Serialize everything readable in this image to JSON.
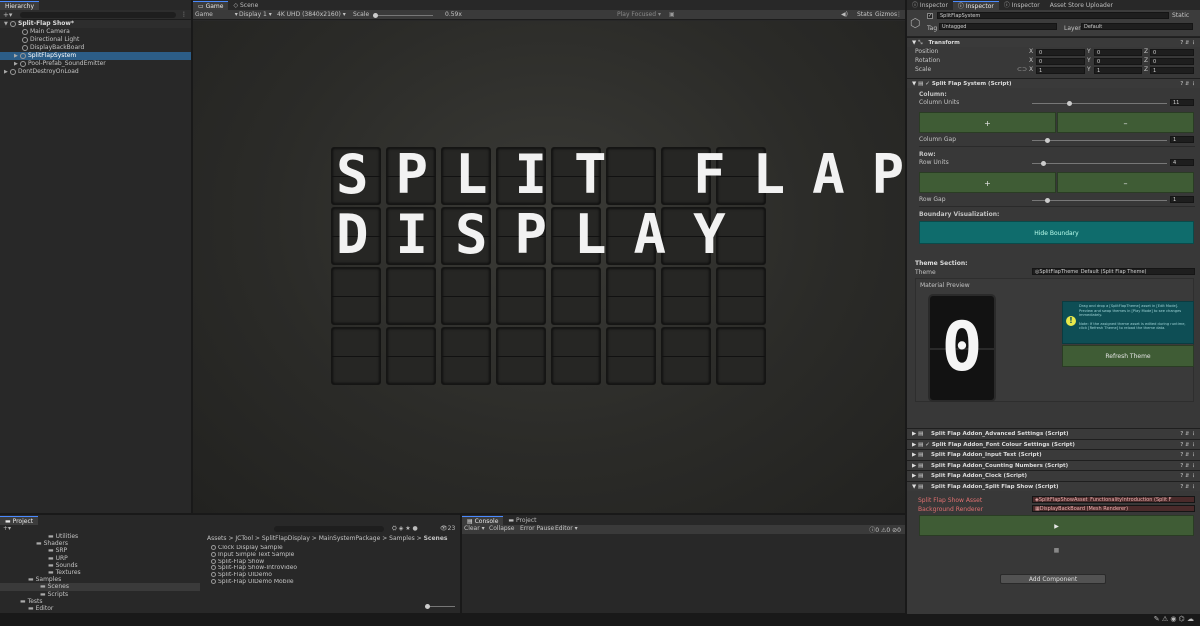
{
  "hierarchy": {
    "tab": "Hierarchy",
    "scene": "Split-Flap Show*",
    "items": [
      "Main Camera",
      "Directional Light",
      "DisplayBackBoard",
      "SplitFlapSystem",
      "Pool-Prefab_SoundEmitter"
    ],
    "dontdestroy": "DontDestroyOnLoad"
  },
  "game": {
    "tabs": [
      "Game",
      "Scene"
    ],
    "mode": "Game",
    "display": "Display 1",
    "resolution": "4K UHD (3840x2160)",
    "scale_label": "Scale",
    "scale_value": "0.59x",
    "play_focused": "Play Focused",
    "stats": "Stats",
    "gizmos": "Gizmos",
    "line1": "SPLIT FLAP",
    "line2": "DISPLAY"
  },
  "inspector": {
    "tabs": [
      "Inspector",
      "Inspector",
      "Inspector",
      "Asset Store Uploader"
    ],
    "object_name": "SplitFlapSystem",
    "static": "Static",
    "tag_label": "Tag",
    "tag_value": "Untagged",
    "layer_label": "Layer",
    "layer_value": "Default",
    "transform": {
      "title": "Transform",
      "rows": [
        {
          "label": "Position",
          "x": "0",
          "y": "0",
          "z": "0"
        },
        {
          "label": "Rotation",
          "x": "0",
          "y": "0",
          "z": "0"
        },
        {
          "label": "Scale",
          "x": "1",
          "y": "1",
          "z": "1"
        }
      ]
    },
    "script": {
      "title": "Split Flap System (Script)",
      "column_header": "Column:",
      "column_units_label": "Column Units",
      "column_units": "11",
      "column_units_level": 0.27,
      "column_gap_label": "Column Gap",
      "column_gap": "1",
      "column_gap_level": 0.1,
      "row_header": "Row:",
      "row_units_label": "Row Units",
      "row_units": "4",
      "row_units_level": 0.07,
      "row_gap_label": "Row Gap",
      "row_gap": "1",
      "row_gap_level": 0.1,
      "plus": "+",
      "minus": "–",
      "boundary_header": "Boundary Visualization:",
      "hide_boundary": "Hide Boundary"
    },
    "theme": {
      "header": "Theme Section:",
      "theme_label": "Theme",
      "theme_value": "SplitFlapTheme_Default (Split Flap Theme)",
      "material_preview": "Material Preview",
      "preview_char": "0",
      "help_text": "Drag and drop a [SplitFlapTheme] asset in [Edit Mode]. Preview and swap themes in [Play Mode] to see changes immediately.",
      "help_note": "Note: If the assigned theme asset is edited during runtime, click [Refresh Theme] to reload the theme data.",
      "refresh": "Refresh Theme"
    },
    "addons": [
      "Split Flap Addon_Advanced Settings (Script)",
      "Split Flap Addon_Font Colour Settings (Script)",
      "Split Flap Addon_Input Text (Script)",
      "Split Flap Addon_Counting Numbers (Script)",
      "Split Flap Addon_Clock (Script)",
      "Split Flap Addon_Split Flap Show (Script)"
    ],
    "show": {
      "asset_label": "Split Flap Show Asset",
      "asset_value": "SplitFlapShowAsset_FunctionalityIntroduction (Split F",
      "renderer_label": "Background Renderer",
      "renderer_value": "DisplayBackBoard (Mesh Renderer)",
      "play": "▶",
      "stop": "■"
    },
    "add_component": "Add Component"
  },
  "project": {
    "tabs": [
      "Project"
    ],
    "tree": [
      "Utilities",
      "Shaders",
      "SRP",
      "URP",
      "Sounds",
      "Textures",
      "Samples",
      "Scenes",
      "Scripts",
      "Tests",
      "Editor"
    ],
    "breadcrumb": [
      "Assets",
      "JCTool",
      "SplitFlapDisplay",
      "MainSystemPackage",
      "Samples",
      "Scenes"
    ],
    "files": [
      "Clock Display Sample",
      "Input Simple Text Sample",
      "Split-Flap Show",
      "Split-Flap Show-IntroVideo",
      "Split-Flap UIDemo",
      "Split-Flap UIDemo Mobile"
    ],
    "count": "23"
  },
  "console": {
    "tabs": [
      "Console",
      "Project"
    ],
    "clear": "Clear",
    "collapse": "Collapse",
    "error_pause": "Error Pause",
    "editor": "Editor",
    "counts": [
      "0",
      "0",
      "0"
    ]
  }
}
